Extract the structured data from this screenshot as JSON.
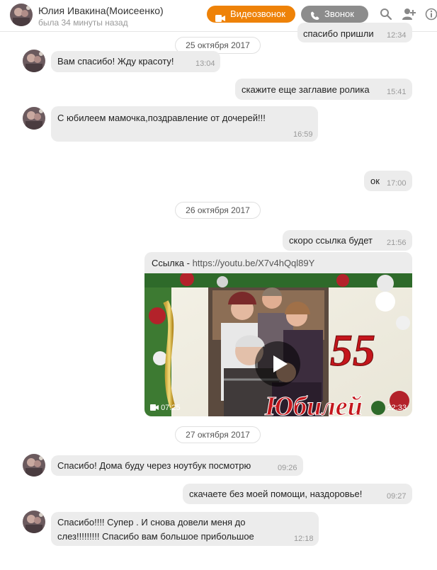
{
  "header": {
    "name": "Юлия Ивакина(Моисеенко)",
    "status": "была 34 минуты назад",
    "video_call_label": "Видеозвонок",
    "call_label": "Звонок"
  },
  "dates": [
    "25 октября 2017",
    "26 октября 2017",
    "27 октября 2017"
  ],
  "messages": [
    {
      "text": "спасибо пришли",
      "time": "12:34"
    },
    {
      "text": "Вам спасибо!  Жду красоту!",
      "time": "13:04"
    },
    {
      "text": "скажите еще заглавие ролика",
      "time": "15:41"
    },
    {
      "text": "С юбилеем мамочка,поздравление от дочерей!!!",
      "time": "16:59"
    },
    {
      "text": "ок",
      "time": "17:00"
    },
    {
      "text": "скоро ссылка будет",
      "time": "21:56"
    },
    {
      "text": "Спасибо! Дома буду через ноутбук посмотрю",
      "time": "09:26"
    },
    {
      "text": "скачаете без моей помощи, наздоровье!",
      "time": "09:27"
    },
    {
      "text": "Спасибо!!!! Супер . И снова довели меня до",
      "text2": "слез!!!!!!!!! Спасибо вам большое прибольшое",
      "time": "12:18"
    }
  ],
  "video": {
    "link_label": "Ссылка - ",
    "link_url": "https://youtu.be/X7v4hQql89Y",
    "duration": "07:25",
    "time": "22:33",
    "thumb_number": "55",
    "thumb_word": "Юбилей"
  }
}
